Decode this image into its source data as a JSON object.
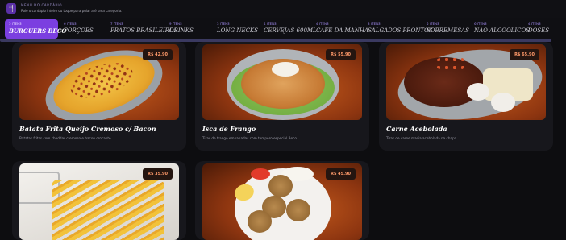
{
  "header": {
    "logo_icon": "fork-knife-icon",
    "title": "MENU DO CARDÁPIO",
    "subtitle": "Role o cardápio inteiro ou toque para pular até uma categoria."
  },
  "tabs": [
    {
      "count": "5 ITENS",
      "label": "BURGUERS BECO",
      "active": true
    },
    {
      "count": "6 ITENS",
      "label": "PORÇÕES"
    },
    {
      "count": "7 ITENS",
      "label": "PRATOS BRASILEIROS"
    },
    {
      "count": "9 ITENS",
      "label": "DRINKS"
    },
    {
      "count": "3 ITENS",
      "label": "LONG NECKS"
    },
    {
      "count": "4 ITENS",
      "label": "CERVEJAS 600ML"
    },
    {
      "count": "4 ITENS",
      "label": "CAFÉ DA MANHÃ"
    },
    {
      "count": "8 ITENS",
      "label": "SALGADOS PRONTOS"
    },
    {
      "count": "5 ITENS",
      "label": "SOBREMESAS"
    },
    {
      "count": "6 ITENS",
      "label": "NÃO ALCOÓLICOS"
    },
    {
      "count": "4 ITENS",
      "label": "DOSES"
    }
  ],
  "cards": [
    {
      "name": "Batata Frita Queijo Cremoso c/ Bacon",
      "price": "R$ 42.90",
      "desc": "Batatas fritas com cheddar cremoso e bacon crocante."
    },
    {
      "name": "Isca de Frango",
      "price": "R$ 55.90",
      "desc": "Tiras de frango empanadas com tempero especial Beco."
    },
    {
      "name": "Carne Acebolada",
      "price": "R$ 65.90",
      "desc": "Tiras de carne macia acebolada na chapa."
    },
    {
      "name": "",
      "price": "R$ 35.90",
      "desc": ""
    },
    {
      "name": "",
      "price": "R$ 45.90",
      "desc": ""
    }
  ]
}
